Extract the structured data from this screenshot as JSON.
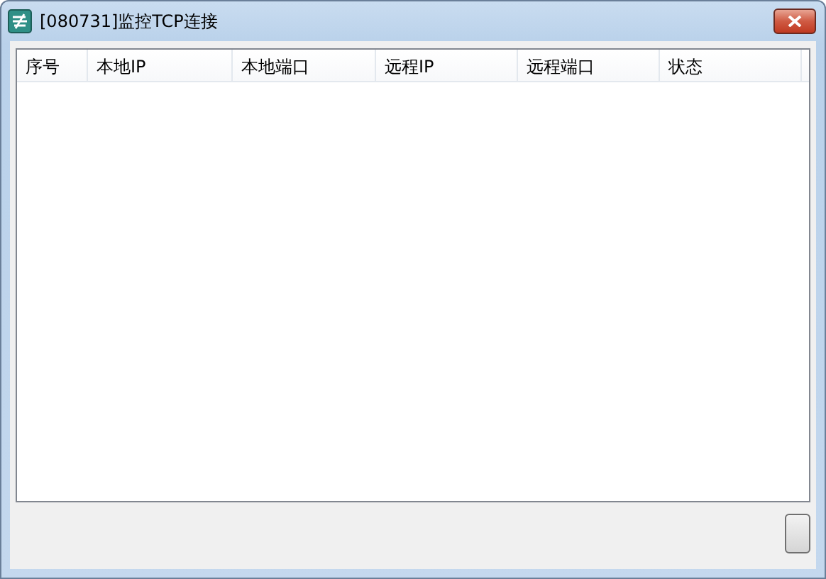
{
  "window": {
    "title": "[080731]监控TCP连接"
  },
  "table": {
    "columns": [
      "序号",
      "本地IP",
      "本地端口",
      "远程IP",
      "远程端口",
      "状态"
    ]
  }
}
